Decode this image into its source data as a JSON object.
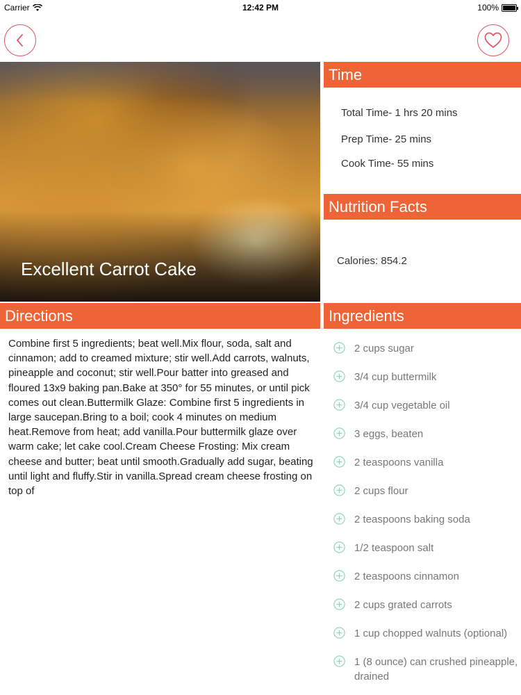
{
  "status_bar": {
    "carrier": "Carrier",
    "time": "12:42 PM",
    "battery": "100%",
    "battery_level": 1.0
  },
  "nav": {
    "back_icon": "chevron-left-icon",
    "favorite_icon": "heart-icon",
    "accent_color": "#e05a6a"
  },
  "recipe": {
    "title": "Excellent Carrot Cake"
  },
  "time": {
    "heading": "Time",
    "total": "Total Time- 1 hrs 20 mins",
    "prep": "Prep Time- 25 mins",
    "cook": "Cook Time-  55 mins"
  },
  "nutrition": {
    "heading": "Nutrition Facts",
    "calories": "Calories: 854.2"
  },
  "directions": {
    "heading": "Directions",
    "text": "Combine first 5 ingredients; beat well.Mix flour, soda, salt and cinnamon; add to creamed mixture; stir well.Add carrots, walnuts, pineapple and coconut; stir well.Pour batter into greased and floured 13x9 baking pan.Bake at 350° for 55 minutes, or until pick comes out clean.Buttermilk Glaze: Combine first 5 ingredients in large saucepan.Bring to a boil; cook 4 minutes on medium heat.Remove from heat; add vanilla.Pour buttermilk glaze over warm cake; let cake cool.Cream Cheese Frosting: Mix cream cheese and butter; beat until smooth.Gradually add sugar, beating until light and fluffy.Stir in vanilla.Spread cream cheese frosting on top of"
  },
  "ingredients": {
    "heading": "Ingredients",
    "icon": "plus-circle-icon",
    "icon_color": "#8fd4b8",
    "items": [
      "2 cups sugar",
      "3/4 cup buttermilk",
      "3/4 cup vegetable oil",
      "3 eggs, beaten",
      "2 teaspoons vanilla",
      "2 cups flour",
      "2 teaspoons baking soda",
      "1/2 teaspoon salt",
      "2 teaspoons cinnamon",
      "2 cups grated carrots",
      "1 cup chopped walnuts (optional)",
      "1 (8 ounce) can crushed pineapple, drained"
    ]
  },
  "colors": {
    "header_orange": "#ef6436"
  }
}
